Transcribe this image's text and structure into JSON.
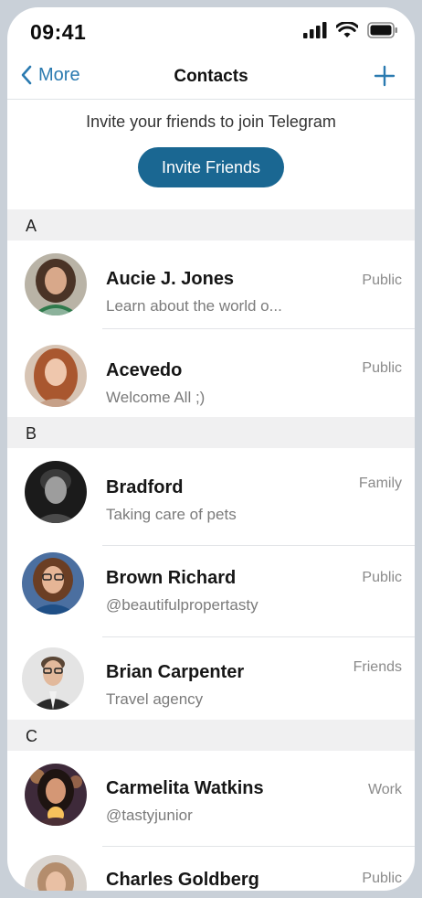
{
  "status": {
    "time": "09:41"
  },
  "nav": {
    "back_label": "More",
    "title": "Contacts"
  },
  "invite": {
    "text": "Invite your friends to join Telegram",
    "button_label": "Invite Friends"
  },
  "sections": [
    {
      "letter": "A",
      "contacts": [
        {
          "name": "Aucie J. Jones",
          "subtitle": "Learn about the world o...",
          "tag": "Public"
        },
        {
          "name": "Acevedo",
          "subtitle": "Welcome All ;)",
          "tag": "Public"
        }
      ]
    },
    {
      "letter": "B",
      "contacts": [
        {
          "name": "Bradford",
          "subtitle": "Taking care of pets",
          "tag": "Family"
        },
        {
          "name": "Brown Richard",
          "subtitle": "@beautifulpropertasty",
          "tag": "Public"
        },
        {
          "name": "Brian Carpenter",
          "subtitle": "Travel agency",
          "tag": "Friends"
        }
      ]
    },
    {
      "letter": "C",
      "contacts": [
        {
          "name": "Carmelita Watkins",
          "subtitle": "@tastyjunior",
          "tag": "Work"
        },
        {
          "name": "Charles Goldberg",
          "subtitle": "",
          "tag": "Public"
        }
      ]
    }
  ],
  "colors": {
    "accent": "#2a7ab0",
    "button": "#1a6792",
    "section_bg": "#f0f0f1"
  }
}
